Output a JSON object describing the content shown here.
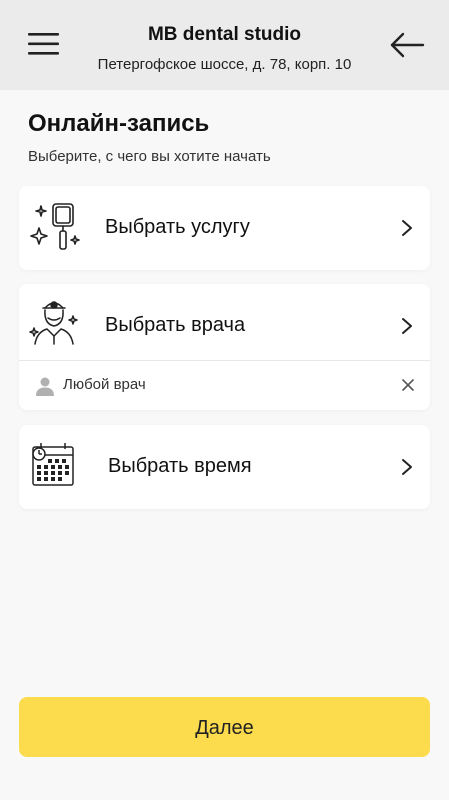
{
  "header": {
    "clinic_name": "MB dental studio",
    "address": "Петергофское шоссе, д. 78, корп. 10",
    "menu_icon": "hamburger-menu-icon",
    "back_icon": "arrow-left-icon"
  },
  "main": {
    "title": "Онлайн-запись",
    "subtitle": "Выберите, с чего вы хотите начать",
    "cards": [
      {
        "label": "Выбрать услугу",
        "icon": "dental-mirror-icon"
      },
      {
        "label": "Выбрать врача",
        "icon": "doctor-icon"
      },
      {
        "label": "Выбрать время",
        "icon": "calendar-icon"
      }
    ],
    "doctor_selection": {
      "label": "Любой врач",
      "icon": "person-icon",
      "clear_icon": "close-icon"
    }
  },
  "footer": {
    "next_label": "Далее"
  },
  "colors": {
    "accent": "#fcdc4d",
    "header_bg": "#ebebeb",
    "page_bg": "#f8f8f8",
    "card_bg": "#ffffff"
  }
}
